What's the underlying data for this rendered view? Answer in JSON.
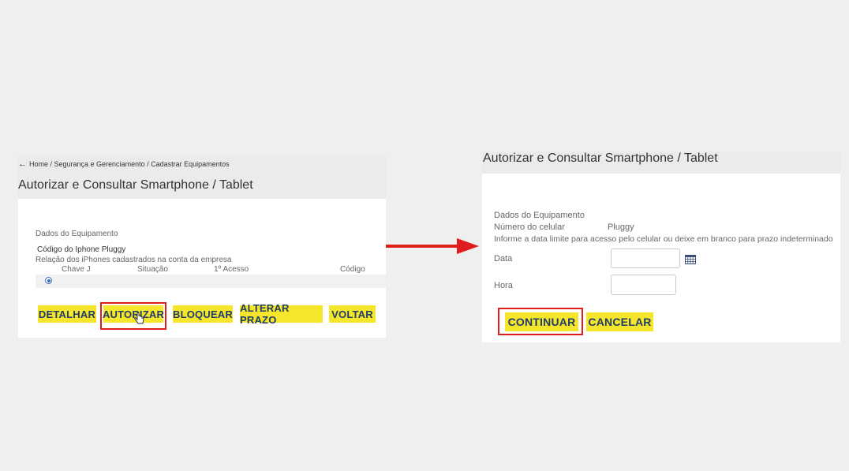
{
  "left": {
    "breadcrumb": "Home / Segurança e Gerenciamento / Cadastrar Equipamentos",
    "title": "Autorizar e Consultar Smartphone / Tablet",
    "section_label": "Dados do Equipamento",
    "code_label": "Código do Iphone Pluggy",
    "relation_label": "Relação dos iPhones cadastrados na conta da empresa",
    "table_headers": [
      "Chave J",
      "Situação",
      "1º Acesso",
      "Código"
    ],
    "buttons": {
      "detalhar": "DETALHAR",
      "autorizar": "AUTORIZAR",
      "bloquear": "BLOQUEAR",
      "alterar_prazo": "ALTERAR PRAZO",
      "voltar": "VOLTAR"
    }
  },
  "right": {
    "title": "Autorizar e Consultar Smartphone / Tablet",
    "section_label": "Dados do Equipamento",
    "phone_label": "Número do celular",
    "phone_value": "Pluggy",
    "instruction": "Informe a data limite para acesso pelo celular ou deixe em branco para prazo indeterminado",
    "date_label": "Data",
    "time_label": "Hora",
    "buttons": {
      "continuar": "CONTINUAR",
      "cancelar": "CANCELAR"
    }
  },
  "colors": {
    "button_bg": "#f5e52b",
    "button_text": "#1f3d68",
    "highlight": "#e01d1d"
  }
}
